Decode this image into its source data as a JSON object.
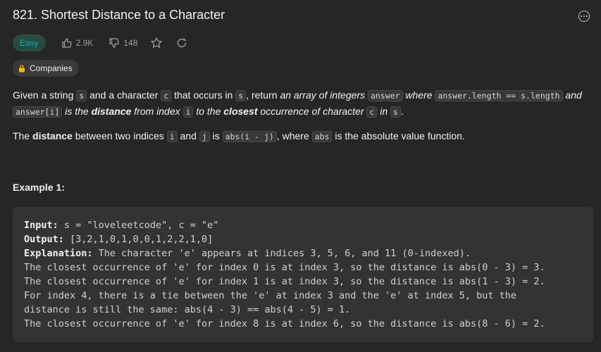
{
  "problem": {
    "title": "821. Shortest Distance to a Character",
    "difficulty": "Easy",
    "likes": "2.9K",
    "dislikes": "148",
    "companies_label": "Companies"
  },
  "desc": {
    "p1": [
      "Given a string ",
      "s",
      " and a character ",
      "c",
      " that occurs in ",
      "s",
      ", return ",
      "an array of integers",
      "answer",
      "where",
      "answer.length == s.length",
      "and",
      "answer[i]",
      "is the",
      "distance",
      "from index",
      "i",
      "to the",
      "closest",
      "occurrence of character",
      "c",
      "in",
      "s",
      "."
    ],
    "p2": [
      "The ",
      "distance",
      " between two indices ",
      "i",
      " and ",
      "j",
      " is ",
      "abs(i - j)",
      ", where ",
      "abs",
      " is the absolute value function."
    ]
  },
  "example": {
    "title": "Example 1:",
    "input_label": "Input:",
    "input_value": " s = \"loveleetcode\", c = \"e\"",
    "output_label": "Output:",
    "output_value": " [3,2,1,0,1,0,0,1,2,2,1,0]",
    "explanation_label": "Explanation:",
    "explanation_lines": [
      " The character 'e' appears at indices 3, 5, 6, and 11 (0-indexed).",
      "The closest occurrence of 'e' for index 0 is at index 3, so the distance is abs(0 - 3) = 3.",
      "The closest occurrence of 'e' for index 1 is at index 3, so the distance is abs(1 - 3) = 2.",
      "For index 4, there is a tie between the 'e' at index 3 and the 'e' at index 5, but the",
      "distance is still the same: abs(4 - 3) == abs(4 - 5) = 1.",
      "The closest occurrence of 'e' for index 8 is at index 6, so the distance is abs(8 - 6) = 2."
    ]
  }
}
